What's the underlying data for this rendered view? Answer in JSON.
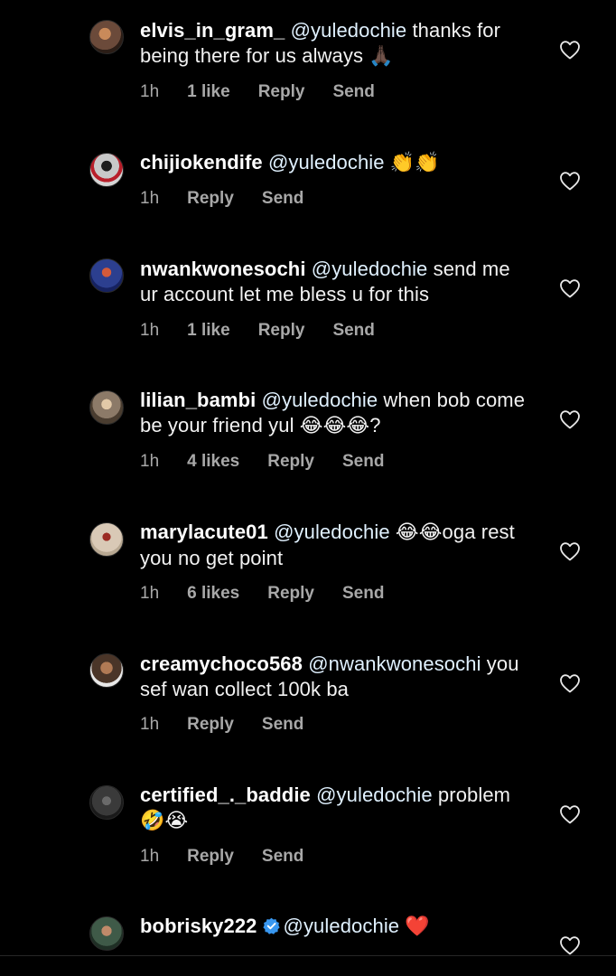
{
  "comments": [
    {
      "username": "elvis_in_gram_",
      "mention": "@yuledochie",
      "text": " thanks for being there for us always",
      "emoji": "🙏🏿",
      "time": "1h",
      "likes": "1 like",
      "reply": "Reply",
      "send": "Send",
      "avatar_color": "#6b4a3a"
    },
    {
      "username": "chijiokendife",
      "mention": "@yuledochie",
      "text": "",
      "emoji": "👏👏",
      "time": "1h",
      "likes": "",
      "reply": "Reply",
      "send": "Send",
      "avatar_color": "#b8b8b8"
    },
    {
      "username": "nwankwonesochi",
      "mention": "@yuledochie",
      "text": " send me ur account let me bless u for this",
      "emoji": "",
      "time": "1h",
      "likes": "1 like",
      "reply": "Reply",
      "send": "Send",
      "avatar_color": "#2c3f8f"
    },
    {
      "username": "lilian_bambi",
      "mention": "@yuledochie",
      "text": " when bob come be your friend yul",
      "emoji": "😂😂😂",
      "text_after": "?",
      "time": "1h",
      "likes": "4 likes",
      "reply": "Reply",
      "send": "Send",
      "avatar_color": "#8c7a68"
    },
    {
      "username": "marylacute01",
      "mention": "@yuledochie",
      "text": "",
      "emoji": "😂😂",
      "text_after": "oga rest you no get point",
      "time": "1h",
      "likes": "6 likes",
      "reply": "Reply",
      "send": "Send",
      "avatar_color": "#d9c9b6"
    },
    {
      "username": "creamychoco568",
      "mention": "@nwankwonesochi",
      "text": " you sef wan collect 100k ba",
      "emoji": "",
      "time": "1h",
      "likes": "",
      "reply": "Reply",
      "send": "Send",
      "avatar_color": "#4a3528"
    },
    {
      "username": "certified_._baddie",
      "mention": "@yuledochie",
      "text": " problem",
      "emoji": "🤣😭",
      "time": "1h",
      "likes": "",
      "reply": "Reply",
      "send": "Send",
      "avatar_color": "#3a3a3a"
    },
    {
      "username": "bobrisky222",
      "mention": "@yuledochie",
      "text": "",
      "emoji": "❤️",
      "time": "",
      "likes": "",
      "reply": "",
      "send": "",
      "avatar_color": "#3f5a48",
      "verified": true
    }
  ],
  "colors": {
    "background": "#000000",
    "text": "#f2f2f2",
    "meta": "#a8a8a8",
    "verified": "#3897f0",
    "heart_red": "#e0245e"
  },
  "icons": {
    "like": "heart-outline-icon",
    "verified": "verified-badge-icon"
  }
}
